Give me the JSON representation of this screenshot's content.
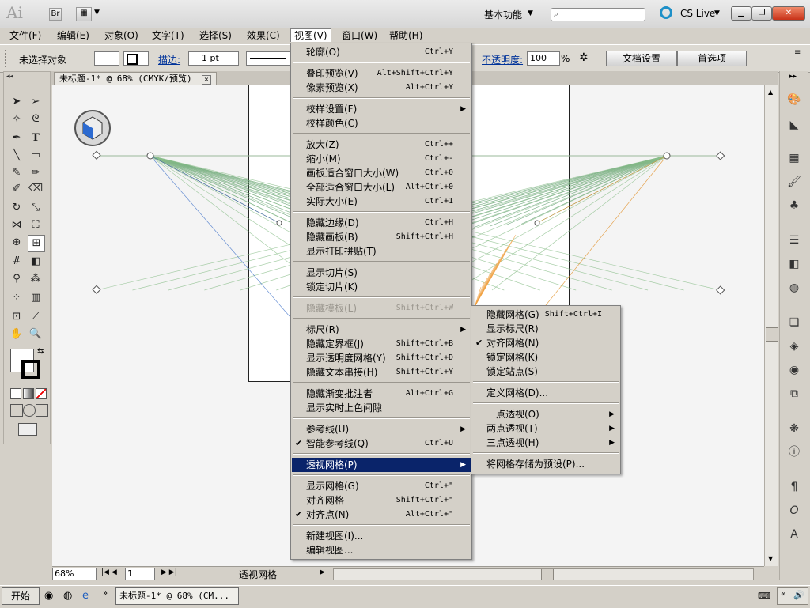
{
  "titlebar": {
    "app_logo": "Ai",
    "bridge_label": "Br",
    "workspace": "基本功能",
    "cs_live": "CS Live"
  },
  "menubar": [
    "文件(F)",
    "编辑(E)",
    "对象(O)",
    "文字(T)",
    "选择(S)",
    "效果(C)",
    "视图(V)",
    "窗口(W)",
    "帮助(H)"
  ],
  "controlbar": {
    "selection_status": "未选择对象",
    "stroke_label": "描边:",
    "stroke_weight": "1 pt",
    "opacity_label": "不透明度:",
    "opacity_value": "100",
    "opacity_unit": "%",
    "doc_setup": "文档设置",
    "preferences": "首选项"
  },
  "document": {
    "tab_title": "未标题-1* @ 68% (CMYK/预览)",
    "zoom": "68%",
    "artboard_number": "1",
    "status_text": "透视网格"
  },
  "view_menu": [
    {
      "label": "轮廓(O)",
      "shortcut": "Ctrl+Y"
    },
    {
      "separator": true
    },
    {
      "label": "叠印预览(V)",
      "shortcut": "Alt+Shift+Ctrl+Y"
    },
    {
      "label": "像素预览(X)",
      "shortcut": "Alt+Ctrl+Y"
    },
    {
      "separator": true
    },
    {
      "label": "校样设置(F)",
      "submenu": true
    },
    {
      "label": "校样颜色(C)"
    },
    {
      "separator": true
    },
    {
      "label": "放大(Z)",
      "shortcut": "Ctrl++"
    },
    {
      "label": "缩小(M)",
      "shortcut": "Ctrl+-"
    },
    {
      "label": "画板适合窗口大小(W)",
      "shortcut": "Ctrl+0"
    },
    {
      "label": "全部适合窗口大小(L)",
      "shortcut": "Alt+Ctrl+0"
    },
    {
      "label": "实际大小(E)",
      "shortcut": "Ctrl+1"
    },
    {
      "separator": true
    },
    {
      "label": "隐藏边缘(D)",
      "shortcut": "Ctrl+H"
    },
    {
      "label": "隐藏画板(B)",
      "shortcut": "Shift+Ctrl+H"
    },
    {
      "label": "显示打印拼贴(T)"
    },
    {
      "separator": true
    },
    {
      "label": "显示切片(S)"
    },
    {
      "label": "锁定切片(K)"
    },
    {
      "separator": true
    },
    {
      "label": "隐藏模板(L)",
      "shortcut": "Shift+Ctrl+W",
      "disabled": true
    },
    {
      "separator": true
    },
    {
      "label": "标尺(R)",
      "submenu": true
    },
    {
      "label": "隐藏定界框(J)",
      "shortcut": "Shift+Ctrl+B"
    },
    {
      "label": "显示透明度网格(Y)",
      "shortcut": "Shift+Ctrl+D"
    },
    {
      "label": "隐藏文本串接(H)",
      "shortcut": "Shift+Ctrl+Y"
    },
    {
      "separator": true
    },
    {
      "label": "隐藏渐变批注者",
      "shortcut": "Alt+Ctrl+G"
    },
    {
      "label": "显示实时上色间隙"
    },
    {
      "separator": true
    },
    {
      "label": "参考线(U)",
      "submenu": true
    },
    {
      "label": "智能参考线(Q)",
      "shortcut": "Ctrl+U",
      "checked": true
    },
    {
      "separator": true
    },
    {
      "label": "透视网格(P)",
      "submenu": true,
      "highlighted": true
    },
    {
      "separator": true
    },
    {
      "label": "显示网格(G)",
      "shortcut": "Ctrl+\""
    },
    {
      "label": "对齐网格",
      "shortcut": "Shift+Ctrl+\""
    },
    {
      "label": "对齐点(N)",
      "shortcut": "Alt+Ctrl+\"",
      "checked": true
    },
    {
      "separator": true
    },
    {
      "label": "新建视图(I)..."
    },
    {
      "label": "编辑视图..."
    }
  ],
  "perspective_submenu": [
    {
      "label": "隐藏网格(G)",
      "shortcut": "Shift+Ctrl+I"
    },
    {
      "label": "显示标尺(R)"
    },
    {
      "label": "对齐网格(N)",
      "checked": true
    },
    {
      "label": "锁定网格(K)"
    },
    {
      "label": "锁定站点(S)"
    },
    {
      "separator": true
    },
    {
      "label": "定义网格(D)..."
    },
    {
      "separator": true
    },
    {
      "label": "一点透视(O)",
      "submenu": true
    },
    {
      "label": "两点透视(T)",
      "submenu": true
    },
    {
      "label": "三点透视(H)",
      "submenu": true
    },
    {
      "separator": true
    },
    {
      "label": "将网格存储为预设(P)..."
    }
  ],
  "taskbar": {
    "start": "开始",
    "task": "未标题-1* @ 68% (CM..."
  }
}
